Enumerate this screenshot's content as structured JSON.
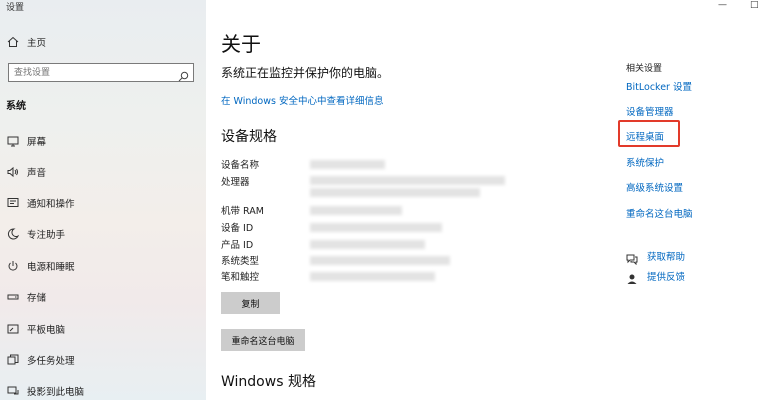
{
  "window": {
    "title": "设置"
  },
  "sidebar": {
    "home": "主页",
    "search": {
      "placeholder": "查找设置"
    },
    "section": "系统",
    "items": [
      {
        "label": "屏幕",
        "icon": "monitor-icon"
      },
      {
        "label": "声音",
        "icon": "speaker-icon"
      },
      {
        "label": "通知和操作",
        "icon": "notification-icon"
      },
      {
        "label": "专注助手",
        "icon": "moon-icon"
      },
      {
        "label": "电源和睡眠",
        "icon": "power-icon"
      },
      {
        "label": "存储",
        "icon": "storage-icon"
      },
      {
        "label": "平板电脑",
        "icon": "tablet-icon"
      },
      {
        "label": "多任务处理",
        "icon": "multitask-icon"
      },
      {
        "label": "投影到此电脑",
        "icon": "project-icon"
      }
    ]
  },
  "main": {
    "title": "关于",
    "status": "系统正在监控并保护你的电脑。",
    "security_link": "在 Windows 安全中心中查看详细信息",
    "specs_heading": "设备规格",
    "spec_labels": [
      "设备名称",
      "处理器",
      "机带 RAM",
      "设备 ID",
      "产品 ID",
      "系统类型",
      "笔和触控"
    ],
    "copy_button": "复制",
    "rename_button": "重命名这台电脑",
    "windows_heading": "Windows 规格"
  },
  "related": {
    "heading": "相关设置",
    "links": [
      "BitLocker 设置",
      "设备管理器",
      "远程桌面",
      "系统保护",
      "高级系统设置",
      "重命名这台电脑"
    ],
    "help": "获取帮助",
    "feedback": "提供反馈"
  },
  "colors": {
    "link": "#0067c0",
    "highlight": "#e23a2a"
  }
}
